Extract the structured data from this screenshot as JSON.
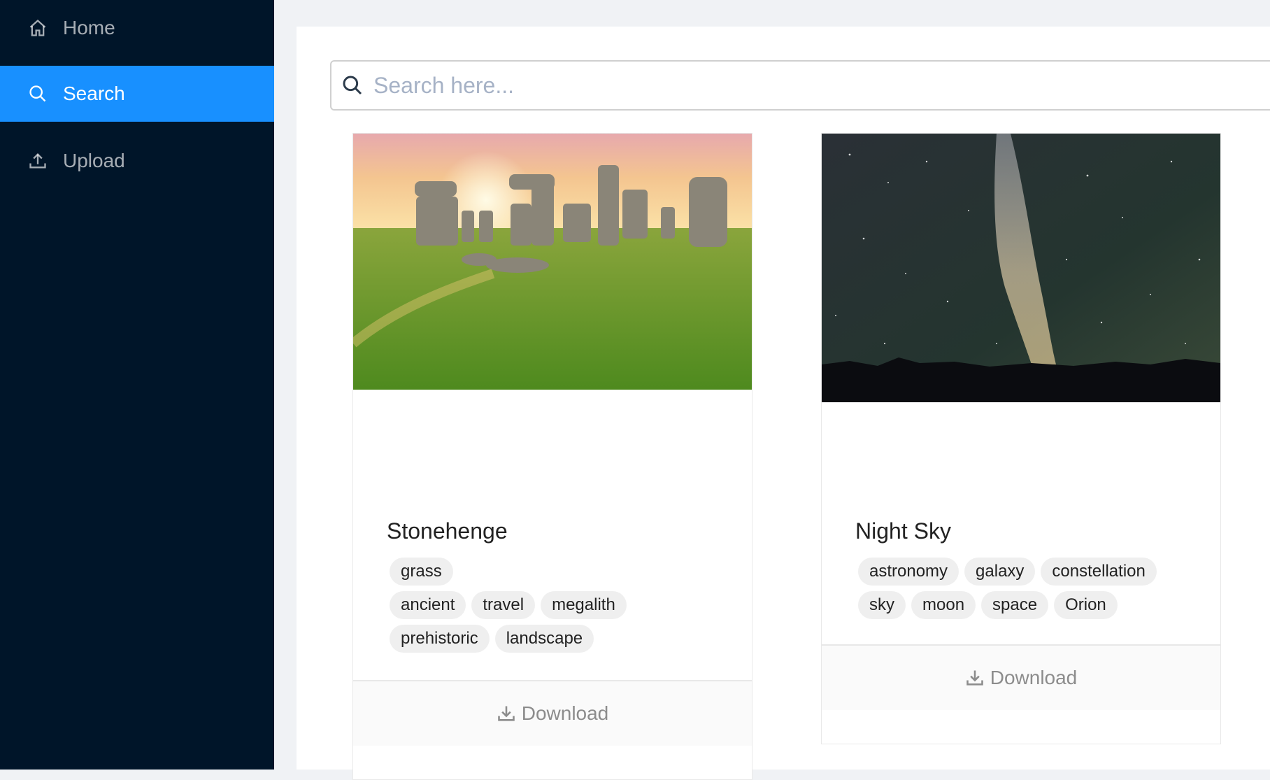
{
  "sidebar": {
    "items": [
      {
        "label": "Home",
        "icon": "home-icon"
      },
      {
        "label": "Search",
        "icon": "search-icon"
      },
      {
        "label": "Upload",
        "icon": "upload-icon"
      }
    ],
    "active": "Search"
  },
  "search": {
    "placeholder": "Search here..."
  },
  "cards": [
    {
      "title": "Stonehenge",
      "tag_rows": [
        [
          "grass"
        ],
        [
          "ancient",
          "travel",
          "megalith"
        ],
        [
          "prehistoric",
          "landscape"
        ]
      ],
      "download_label": "Download"
    },
    {
      "title": "Night Sky",
      "tag_rows": [
        [
          "astronomy",
          "galaxy",
          "constellation"
        ],
        [
          "sky",
          "moon",
          "space",
          "Orion"
        ]
      ],
      "download_label": "Download"
    }
  ],
  "colors": {
    "sidebar_bg": "#001529",
    "active_bg": "#1890ff",
    "page_bg": "#f0f2f5"
  }
}
